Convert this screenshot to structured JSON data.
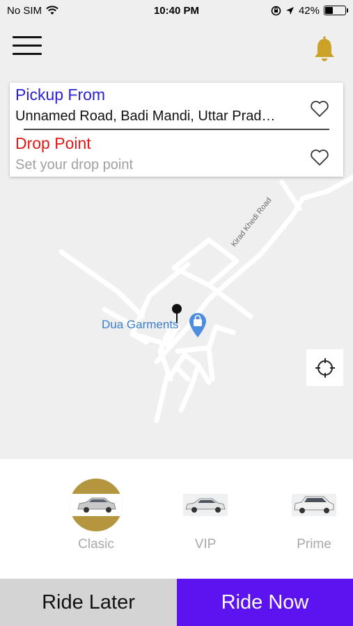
{
  "status_bar": {
    "carrier": "No SIM",
    "time": "10:40 PM",
    "battery": "42%",
    "battery_level": 0.42
  },
  "header": {
    "menu_icon": "hamburger-menu-icon",
    "notification_icon": "bell-icon",
    "accent_color": "#c9a227"
  },
  "address_card": {
    "pickup_label": "Pickup From",
    "pickup_value": "Unnamed Road, Badi Mandi, Uttar Prad…",
    "drop_label": "Drop Point",
    "drop_placeholder": "Set your drop point",
    "pickup_color": "#2a1fd6",
    "drop_color": "#e01818"
  },
  "map": {
    "road_label": "Kirad Khedi Road",
    "place_label": "Dua Garments",
    "locate_icon": "crosshair-icon"
  },
  "vehicles": [
    {
      "name": "Clasic",
      "selected": true
    },
    {
      "name": "VIP",
      "selected": false
    },
    {
      "name": "Prime",
      "selected": false
    }
  ],
  "actions": {
    "ride_later": "Ride Later",
    "ride_now": "Ride Now",
    "ride_now_color": "#5d12f0"
  }
}
